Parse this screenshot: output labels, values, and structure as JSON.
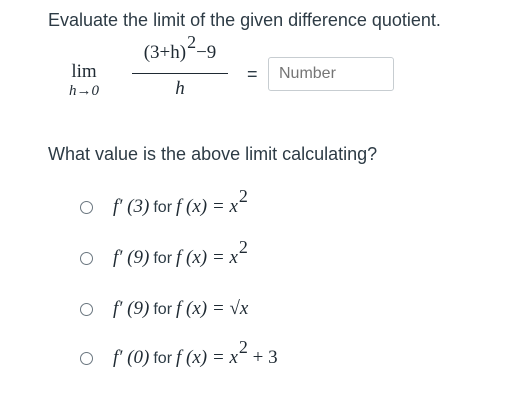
{
  "question": {
    "prompt": "Evaluate the limit of the given difference quotient.",
    "limit": {
      "lim_word": "lim",
      "lim_subscript": "h→0",
      "numerator_base": "(3+h)",
      "numerator_exp": "2",
      "numerator_tail": "−9",
      "denominator": "h"
    },
    "equals": "=",
    "answer_placeholder": "Number"
  },
  "multiple_choice": {
    "prompt": "What value is the above limit calculating?",
    "for_word": "for",
    "options": [
      {
        "deriv": "f′ (3)",
        "func": "f (x) = x",
        "exp": "2",
        "tail": ""
      },
      {
        "deriv": "f′ (9)",
        "func": "f (x) = x",
        "exp": "2",
        "tail": ""
      },
      {
        "deriv": "f′ (9)",
        "func": "f (x)  =  √x",
        "exp": "",
        "tail": ""
      },
      {
        "deriv": "f′ (0)",
        "func": "f (x) = x",
        "exp": "2",
        "tail": " + 3"
      }
    ]
  }
}
